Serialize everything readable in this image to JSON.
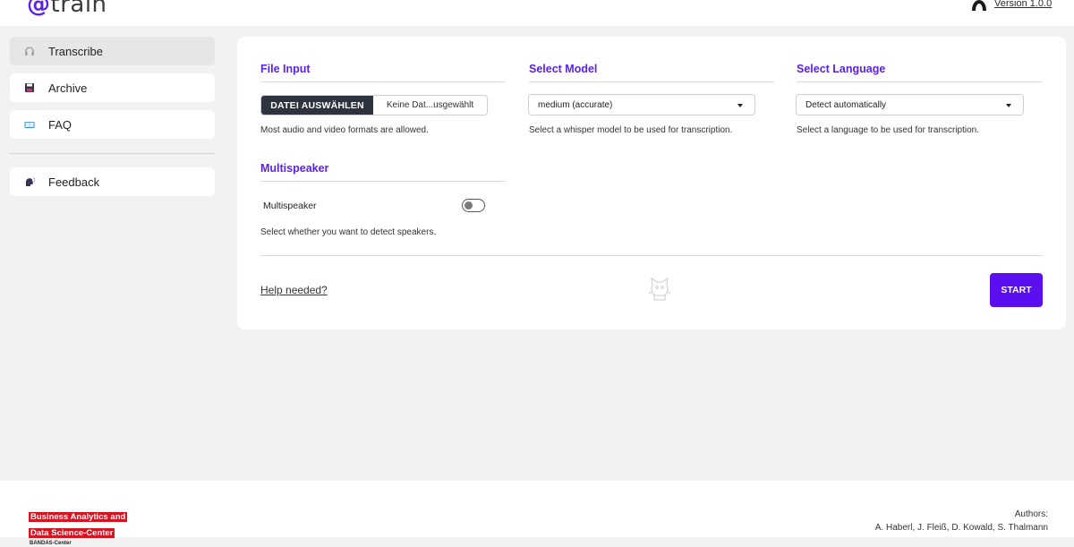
{
  "header": {
    "logo_at": "@",
    "logo_text": "train",
    "version_label": "Version 1.0.0"
  },
  "sidebar": {
    "items": [
      {
        "label": "Transcribe",
        "icon": "headphones-icon",
        "active": true
      },
      {
        "label": "Archive",
        "icon": "save-icon",
        "active": false
      },
      {
        "label": "FAQ",
        "icon": "book-icon",
        "active": false
      },
      {
        "label": "Feedback",
        "icon": "speaking-head-icon",
        "active": false
      }
    ]
  },
  "main": {
    "file_input": {
      "title": "File Input",
      "button_label": "DATEI AUSWÄHLEN",
      "file_name": "Keine Dat...usgewählt",
      "help": "Most audio and video formats are allowed."
    },
    "model": {
      "title": "Select Model",
      "selected": "medium (accurate)",
      "help": "Select a whisper model to be used for transcription."
    },
    "language": {
      "title": "Select Language",
      "selected": "Detect automatically",
      "help": "Select a language to be used for transcription."
    },
    "multispeaker": {
      "title": "Multispeaker",
      "toggle_label": "Multispeaker",
      "enabled": false,
      "help": "Select whether you want to detect speakers."
    },
    "help_link": "Help needed?",
    "start_label": "START"
  },
  "footer": {
    "org_line1": "Business Analytics and",
    "org_line2": "Data Science-Center",
    "org_line3": "BANDAS-Center",
    "authors_title": "Authors:",
    "authors_names": "A. Haberl, J. Fleiß, D. Kowald, S. Thalmann"
  },
  "colors": {
    "accent": "#5b21e6",
    "start_button": "#5b0ff0",
    "file_button": "#2d3440",
    "bandas_red": "#d41421"
  }
}
